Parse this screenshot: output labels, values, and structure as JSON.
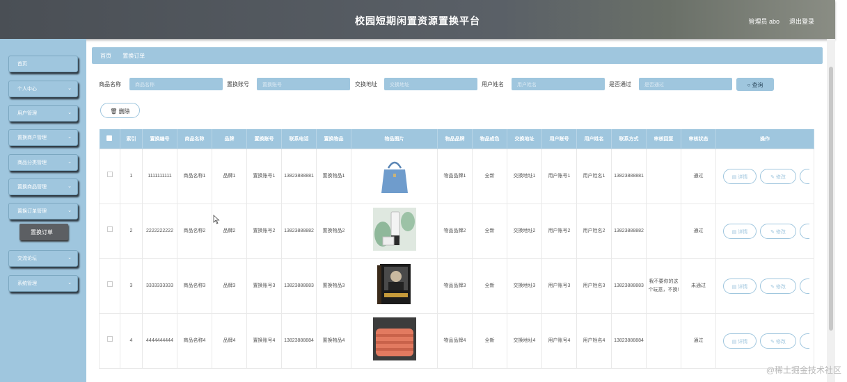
{
  "header": {
    "title": "校园短期闲置资源置换平台",
    "user_label": "管理员 abo",
    "logout_label": "退出登录"
  },
  "sidebar": {
    "items": [
      {
        "label": "首页",
        "has_chevron": false
      },
      {
        "label": "个人中心",
        "has_chevron": true
      },
      {
        "label": "用户管理",
        "has_chevron": true
      },
      {
        "label": "置换商户管理",
        "has_chevron": true
      },
      {
        "label": "商品分类管理",
        "has_chevron": true
      },
      {
        "label": "置换商品管理",
        "has_chevron": true
      },
      {
        "label": "置换订单管理",
        "has_chevron": true
      },
      {
        "label": "交流论坛",
        "has_chevron": true
      },
      {
        "label": "系统管理",
        "has_chevron": true
      }
    ],
    "active_sub": "置换订单"
  },
  "breadcrumb": {
    "home": "首页",
    "current": "置换订单"
  },
  "search": {
    "fields": [
      {
        "label": "商品名称",
        "placeholder": "商品名称"
      },
      {
        "label": "置换账号",
        "placeholder": "置换账号"
      },
      {
        "label": "交换地址",
        "placeholder": "交换地址"
      },
      {
        "label": "用户姓名",
        "placeholder": "用户姓名"
      },
      {
        "label": "是否通过",
        "placeholder": "是否通过"
      }
    ],
    "query_label": "查询"
  },
  "toolbar": {
    "delete_label": "删除"
  },
  "table": {
    "headers": [
      "索引",
      "置换编号",
      "商品名称",
      "品牌",
      "置换账号",
      "联系电话",
      "置换物品",
      "物品图片",
      "物品品牌",
      "物品成色",
      "交换地址",
      "用户账号",
      "用户姓名",
      "联系方式",
      "审核回复",
      "审核状态",
      "操作"
    ],
    "rows": [
      {
        "index": "1",
        "code": "1111111111",
        "name": "商品名称1",
        "brand": "品牌1",
        "account": "置换账号1",
        "phone": "13823888881",
        "item": "置换物品1",
        "image": "handbag",
        "item_brand": "物品品牌1",
        "condition": "全新",
        "address": "交换地址1",
        "user_account": "用户账号1",
        "user_name": "用户姓名1",
        "contact": "13823888881",
        "reply": "",
        "status": "通过"
      },
      {
        "index": "2",
        "code": "2222222222",
        "name": "商品名称2",
        "brand": "品牌2",
        "account": "置换账号2",
        "phone": "13823888882",
        "item": "置换物品2",
        "image": "cosmetics",
        "item_brand": "物品品牌2",
        "condition": "全新",
        "address": "交换地址2",
        "user_account": "用户账号2",
        "user_name": "用户姓名2",
        "contact": "13823888882",
        "reply": "",
        "status": "通过"
      },
      {
        "index": "3",
        "code": "3333333333",
        "name": "商品名称3",
        "brand": "品牌3",
        "account": "置换账号3",
        "phone": "13823888883",
        "item": "置换物品3",
        "image": "book",
        "item_brand": "物品品牌3",
        "condition": "全新",
        "address": "交换地址3",
        "user_account": "用户账号3",
        "user_name": "用户姓名3",
        "contact": "13823888883",
        "reply": "我不要你的这个玩意，不换!",
        "status": "未通过"
      },
      {
        "index": "4",
        "code": "4444444444",
        "name": "商品名称4",
        "brand": "品牌4",
        "account": "置换账号4",
        "phone": "13823888884",
        "item": "置换物品4",
        "image": "blanket",
        "item_brand": "物品品牌4",
        "condition": "全新",
        "address": "交换地址4",
        "user_account": "用户账号4",
        "user_name": "用户姓名4",
        "contact": "13823888884",
        "reply": "",
        "status": "通过"
      }
    ],
    "actions": {
      "detail": "详情",
      "edit": "修改"
    }
  },
  "watermark": "@稀土掘金技术社区"
}
